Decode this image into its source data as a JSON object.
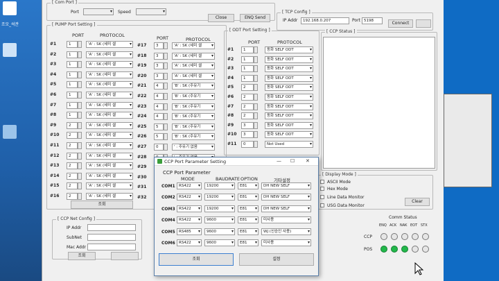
{
  "desktop": {
    "label1": "조오_석관"
  },
  "com_port": {
    "title": "[ Com Port ]",
    "port_label": "Port",
    "speed_label": "Speed",
    "close_button": "Close",
    "enq_send_button": "ENQ Send"
  },
  "tcp_config": {
    "title": "[ TCP Config ]",
    "ip_label": "IP Addr",
    "ip_value": "192.168.0.207",
    "port_label": "Port",
    "port_value": "5198",
    "connect_button": "Connect"
  },
  "pump": {
    "title": "[ PUMP Port Setting ]",
    "col_port": "PORT",
    "col_protocol": "PROTOCOL",
    "rows_a": [
      {
        "no": "#1",
        "port": "1",
        "protocol": "'A' : SK (세미 셀"
      },
      {
        "no": "#2",
        "port": "1",
        "protocol": "'A' : SK (세미 셀"
      },
      {
        "no": "#3",
        "port": "1",
        "protocol": "'A' : SK (세미 셀"
      },
      {
        "no": "#4",
        "port": "1",
        "protocol": "'A' : SK (세미 셀"
      },
      {
        "no": "#5",
        "port": "1",
        "protocol": "'A' : SK (세미 셀"
      },
      {
        "no": "#6",
        "port": "1",
        "protocol": "'A' : SK (세미 셀"
      },
      {
        "no": "#7",
        "port": "1",
        "protocol": "'A' : SK (세미 셀"
      },
      {
        "no": "#8",
        "port": "1",
        "protocol": "'A' : SK (세미 셀"
      },
      {
        "no": "#9",
        "port": "2",
        "protocol": "'A' : SK (세미 셀"
      },
      {
        "no": "#10",
        "port": "2",
        "protocol": "'A' : SK (세미 셀"
      },
      {
        "no": "#11",
        "port": "2",
        "protocol": "'A' : SK (세미 셀"
      },
      {
        "no": "#12",
        "port": "2",
        "protocol": "'A' : SK (세미 셀"
      },
      {
        "no": "#13",
        "port": "2",
        "protocol": "'A' : SK (세미 셀"
      },
      {
        "no": "#14",
        "port": "2",
        "protocol": "'A' : SK (세미 셀"
      },
      {
        "no": "#15",
        "port": "2",
        "protocol": "'A' : SK (세미 셀"
      },
      {
        "no": "#16",
        "port": "2",
        "protocol": "'A' : SK (세미 셀"
      }
    ],
    "rows_b": [
      {
        "no": "#17",
        "port": "3",
        "protocol": "'A' : SK (세미 셀"
      },
      {
        "no": "#18",
        "port": "3",
        "protocol": "'A' : SK (세미 셀"
      },
      {
        "no": "#19",
        "port": "3",
        "protocol": "'A' : SK (세미 셀"
      },
      {
        "no": "#20",
        "port": "3",
        "protocol": "'A' : SK (세미 셀"
      },
      {
        "no": "#21",
        "port": "4",
        "protocol": "'B' : SK (주유기"
      },
      {
        "no": "#22",
        "port": "4",
        "protocol": "'B' : SK (주유기"
      },
      {
        "no": "#23",
        "port": "4",
        "protocol": "'B' : SK (주유기"
      },
      {
        "no": "#24",
        "port": "4",
        "protocol": "'B' : SK (주유기"
      },
      {
        "no": "#25",
        "port": "5",
        "protocol": "'B' : SK (주유기"
      },
      {
        "no": "#26",
        "port": "5",
        "protocol": "'B' : SK (주유기"
      },
      {
        "no": "#27",
        "port": "0",
        "protocol": "' : 주유기 없음"
      },
      {
        "no": "#28",
        "port": "0",
        "protocol": "' : 주유기 없음"
      },
      {
        "no": "#29",
        "port": "",
        "protocol": ""
      },
      {
        "no": "#30",
        "port": "",
        "protocol": ""
      },
      {
        "no": "#31",
        "port": "",
        "protocol": ""
      },
      {
        "no": "#32",
        "port": "",
        "protocol": ""
      }
    ],
    "lookup_button": "조회"
  },
  "odt": {
    "title": "[ ODT Port Setting ]",
    "col_port": "PORT",
    "col_protocol": "PROTOCOL",
    "rows": [
      {
        "no": "#1",
        "port": "1",
        "protocol": "동화 SELF ODT"
      },
      {
        "no": "#2",
        "port": "1",
        "protocol": "동화 SELF ODT"
      },
      {
        "no": "#3",
        "port": "1",
        "protocol": "동화 SELF ODT"
      },
      {
        "no": "#4",
        "port": "1",
        "protocol": "동화 SELF ODT"
      },
      {
        "no": "#5",
        "port": "2",
        "protocol": "동화 SELF ODT"
      },
      {
        "no": "#6",
        "port": "2",
        "protocol": "동화 SELF ODT"
      },
      {
        "no": "#7",
        "port": "2",
        "protocol": "동화 SELF ODT"
      },
      {
        "no": "#8",
        "port": "2",
        "protocol": "동화 SELF ODT"
      },
      {
        "no": "#9",
        "port": "3",
        "protocol": "동화 SELF ODT"
      },
      {
        "no": "#10",
        "port": "3",
        "protocol": "동화 SELF ODT"
      },
      {
        "no": "#11",
        "port": "0",
        "protocol": "Not Used"
      }
    ]
  },
  "ccp_status": {
    "title": "[ CCP Status ]"
  },
  "display_mode": {
    "title": "[ Display Mode ]",
    "ascii": "ASCII Mode",
    "hex": "Hex Mode",
    "line_monitor": "Line Data Monitor",
    "usg_monitor": "USG Data Monitor",
    "clear_button": "Clear"
  },
  "comm_status": {
    "title": "Comm Status",
    "cols": [
      "ENQ",
      "ACK",
      "NAK",
      "EOT",
      "STX"
    ],
    "ccp_label": "CCP",
    "pos_label": "POS",
    "ccp_states": [
      false,
      false,
      false,
      false,
      false
    ],
    "pos_states": [
      true,
      true,
      true,
      false,
      false
    ],
    "on_color": "#22b84a"
  },
  "ccp_net": {
    "title": "[ CCP Net Config ]",
    "ip_label": "IP Addr",
    "subnet_label": "SubNet",
    "mac_label": "Mac Addr",
    "lookup_button": "조회"
  },
  "dialog": {
    "title": "CCP Port Parameter Setting",
    "heading": "CCP Port Parameter",
    "col_mode": "MODE",
    "col_baud": "BAUDRATE",
    "col_option": "OPTION",
    "col_device": "기타설정",
    "rows": [
      {
        "name": "COM1",
        "mode": "RS422",
        "baud": "19200",
        "option": "E81",
        "device": "DH NEW SELF"
      },
      {
        "name": "COM2",
        "mode": "RS422",
        "baud": "19200",
        "option": "E81",
        "device": "DH NEW SELF"
      },
      {
        "name": "COM3",
        "mode": "RS422",
        "baud": "19200",
        "option": "E81",
        "device": "DH NEW SELF"
      },
      {
        "name": "COM4",
        "mode": "RS422",
        "baud": "9600",
        "option": "E81",
        "device": "미사용"
      },
      {
        "name": "COM5",
        "mode": "RS485",
        "baud": "9600",
        "option": "E81",
        "device": "WJ (신승인 사용)"
      },
      {
        "name": "COM6",
        "mode": "RS422",
        "baud": "9600",
        "option": "E81",
        "device": "미사용"
      }
    ],
    "lookup_button": "조회",
    "set_button": "설정",
    "minimize_glyph": "—",
    "maximize_glyph": "☐",
    "close_glyph": "✕"
  }
}
